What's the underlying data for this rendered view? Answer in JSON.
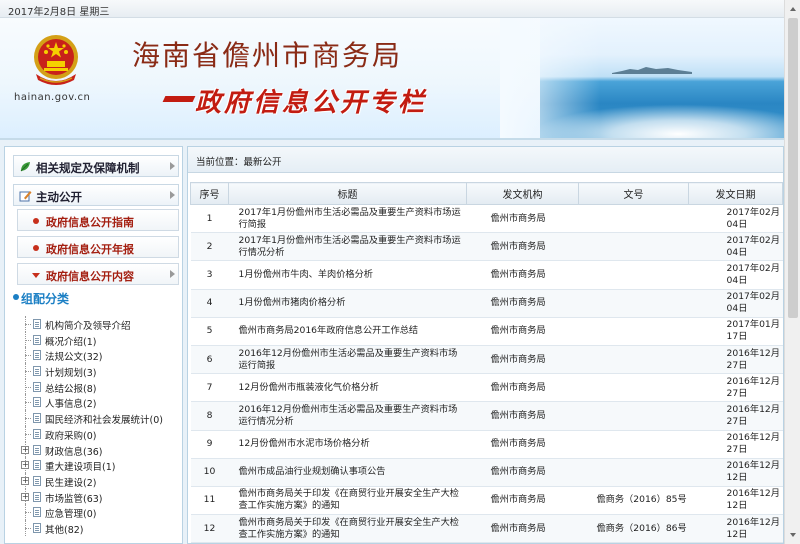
{
  "header": {
    "date_text": "2017年2月8日 星期三",
    "site_title": "海南省儋州市商务局",
    "column_title": "政府信息公开专栏",
    "domain": "hainan.gov.cn"
  },
  "sidebar": {
    "heads": [
      {
        "label": "相关规定及保障机制",
        "icon": "leaf-icon"
      },
      {
        "label": "主动公开",
        "icon": "pen-icon"
      }
    ],
    "subs": [
      {
        "label": "政府信息公开指南"
      },
      {
        "label": "政府信息公开年报"
      },
      {
        "label": "政府信息公开内容"
      }
    ],
    "category_heading": "组配分类",
    "tree": [
      {
        "label": "机构简介及领导介绍",
        "expandable": false
      },
      {
        "label": "概况介绍(1)",
        "expandable": false
      },
      {
        "label": "法规公文(32)",
        "expandable": false
      },
      {
        "label": "计划规划(3)",
        "expandable": false
      },
      {
        "label": "总结公报(8)",
        "expandable": false
      },
      {
        "label": "人事信息(2)",
        "expandable": false
      },
      {
        "label": "国民经济和社会发展统计(0)",
        "expandable": false
      },
      {
        "label": "政府采购(0)",
        "expandable": false
      },
      {
        "label": "财政信息(36)",
        "expandable": true
      },
      {
        "label": "重大建设项目(1)",
        "expandable": true
      },
      {
        "label": "民生建设(2)",
        "expandable": true
      },
      {
        "label": "市场监管(63)",
        "expandable": true
      },
      {
        "label": "应急管理(0)",
        "expandable": false
      },
      {
        "label": "其他(82)",
        "expandable": false
      }
    ]
  },
  "main": {
    "breadcrumb": "当前位置：最新公开",
    "columns": [
      "序号",
      "标题",
      "发文机构",
      "文号",
      "发文日期"
    ],
    "rows": [
      {
        "no": "1",
        "title": "2017年1月份儋州市生活必需品及重要生产资料市场运行简报",
        "org": "儋州市商务局",
        "num": "",
        "date": "2017年02月04日"
      },
      {
        "no": "2",
        "title": "2017年1月份儋州市生活必需品及重要生产资料市场运行情况分析",
        "org": "儋州市商务局",
        "num": "",
        "date": "2017年02月04日"
      },
      {
        "no": "3",
        "title": "1月份儋州市牛肉、羊肉价格分析",
        "org": "儋州市商务局",
        "num": "",
        "date": "2017年02月04日"
      },
      {
        "no": "4",
        "title": "1月份儋州市猪肉价格分析",
        "org": "儋州市商务局",
        "num": "",
        "date": "2017年02月04日"
      },
      {
        "no": "5",
        "title": "儋州市商务局2016年政府信息公开工作总结",
        "org": "儋州市商务局",
        "num": "",
        "date": "2017年01月17日"
      },
      {
        "no": "6",
        "title": "2016年12月份儋州市生活必需品及重要生产资料市场运行简报",
        "org": "儋州市商务局",
        "num": "",
        "date": "2016年12月27日"
      },
      {
        "no": "7",
        "title": "12月份儋州市瓶装液化气价格分析",
        "org": "儋州市商务局",
        "num": "",
        "date": "2016年12月27日"
      },
      {
        "no": "8",
        "title": "2016年12月份儋州市生活必需品及重要生产资料市场运行情况分析",
        "org": "儋州市商务局",
        "num": "",
        "date": "2016年12月27日"
      },
      {
        "no": "9",
        "title": "12月份儋州市水泥市场价格分析",
        "org": "儋州市商务局",
        "num": "",
        "date": "2016年12月27日"
      },
      {
        "no": "10",
        "title": "儋州市成品油行业规划确认事项公告",
        "org": "儋州市商务局",
        "num": "",
        "date": "2016年12月12日"
      },
      {
        "no": "11",
        "title": "儋州市商务局关于印发《在商贸行业开展安全生产大检查工作实施方案》的通知",
        "org": "儋州市商务局",
        "num": "儋商务（2016）85号",
        "date": "2016年12月12日"
      },
      {
        "no": "12",
        "title": "儋州市商务局关于印发《在商贸行业开展安全生产大检查工作实施方案》的通知",
        "org": "儋州市商务局",
        "num": "儋商务（2016）86号",
        "date": "2016年12月12日"
      }
    ]
  },
  "colors": {
    "site_title": "#8a2b16",
    "column_title": "#c21c11",
    "category_heading": "#1b7fc4",
    "sub_label": "#a41f11"
  }
}
